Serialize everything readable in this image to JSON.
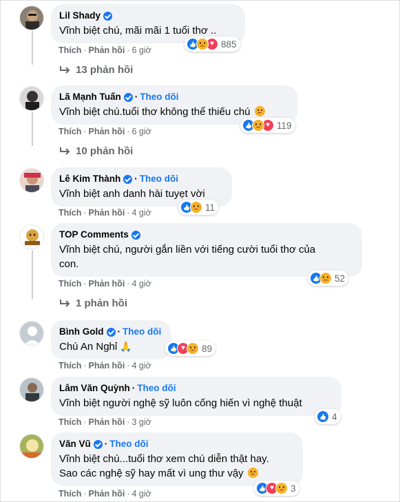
{
  "comments": [
    {
      "name": "Lil Shady",
      "verified": true,
      "follow": "",
      "text": "Vĩnh biệt chú, mãi mãi 1 tuổi thơ ..",
      "like": "Thích",
      "reply": "Phản hồi",
      "time": "6 giờ",
      "reaction_count": "885",
      "reactions": [
        "like",
        "sad",
        "love"
      ],
      "replies": "13 phản hồi"
    },
    {
      "name": "Lã Mạnh Tuấn",
      "verified": true,
      "follow": "Theo dõi",
      "text": "Vĩnh biệt chú.tuổi thơ không thể thiếu chú",
      "emoji": "sad",
      "like": "Thích",
      "reply": "Phản hồi",
      "time": "6 giờ",
      "reaction_count": "119",
      "reactions": [
        "like",
        "sad",
        "love"
      ],
      "replies": "10 phản hồi"
    },
    {
      "name": "Lê Kim Thành",
      "verified": true,
      "follow": "Theo dõi",
      "text": "Vĩnh biệt anh danh hài tuyẹt vời",
      "like": "Thích",
      "reply": "Phản hồi",
      "time": "4 giờ",
      "reaction_count": "11",
      "reactions": [
        "like",
        "sad"
      ]
    },
    {
      "name": "TOP Comments",
      "verified": true,
      "follow": "",
      "text_line1": "Vĩnh biệt chú, người gắn liền với tiếng cười tuổi thơ của",
      "text_line2": "con.",
      "like": "Thích",
      "reply": "Phản hồi",
      "time": "4 giờ",
      "reaction_count": "52",
      "reactions": [
        "like",
        "sad"
      ],
      "replies": "1 phản hồi"
    },
    {
      "name": "Bình Gold",
      "verified": true,
      "follow": "Theo dõi",
      "text": "Chú An Nghỉ",
      "emoji": "🙏",
      "like": "Thích",
      "reply": "Phản hồi",
      "time": "4 giờ",
      "reaction_count": "89",
      "reactions": [
        "like",
        "love",
        "sad"
      ]
    },
    {
      "name": "Lâm Văn Quỳnh",
      "verified": false,
      "follow": "Theo dõi",
      "text": "Vĩnh biệt người nghệ sỹ luôn cống hiến vì nghệ thuật",
      "like": "Thích",
      "reply": "Phản hồi",
      "time": "3 giờ",
      "reaction_count": "4",
      "reactions": [
        "like"
      ]
    },
    {
      "name": "Văn Vũ",
      "verified": true,
      "follow": "Theo dõi",
      "text_line1": "Vĩnh biệt chú...tuổi thơ xem chú diễn thật hay.",
      "text_line2": "Sao các nghệ sỹ hay mất vì ung thư vậy",
      "emoji": "sad",
      "like": "Thích",
      "reply": "Phản hồi",
      "time": "4 giờ",
      "reaction_count": "3",
      "reactions": [
        "like",
        "love",
        "sad"
      ]
    }
  ],
  "colors": {
    "accent": "#1877f2",
    "bubble": "#f0f2f5",
    "secondary_text": "#65676b"
  }
}
